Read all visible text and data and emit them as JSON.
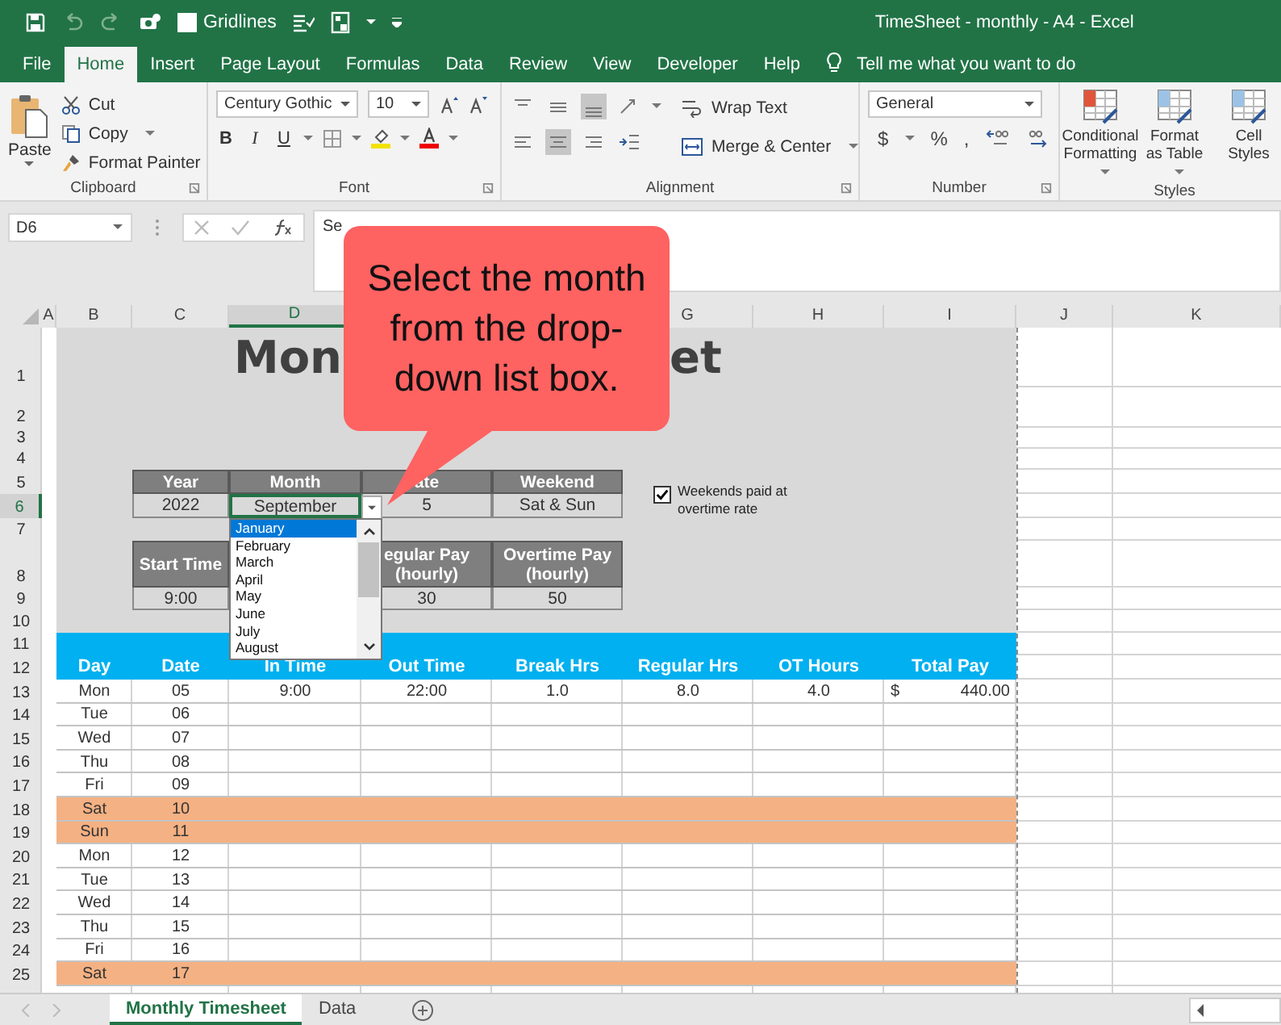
{
  "title_bar": {
    "gridlines": {
      "label": "Gridlines",
      "checked": false
    },
    "title": "TimeSheet - monthly - A4 - Excel"
  },
  "ribbon_tabs": [
    {
      "label": "File",
      "selected": false
    },
    {
      "label": "Home",
      "selected": true
    },
    {
      "label": "Insert",
      "selected": false
    },
    {
      "label": "Page Layout",
      "selected": false
    },
    {
      "label": "Formulas",
      "selected": false
    },
    {
      "label": "Data",
      "selected": false
    },
    {
      "label": "Review",
      "selected": false
    },
    {
      "label": "View",
      "selected": false
    },
    {
      "label": "Developer",
      "selected": false
    },
    {
      "label": "Help",
      "selected": false
    }
  ],
  "tell_me": "Tell me what you want to do",
  "clipboard": {
    "paste": "Paste",
    "cut": "Cut",
    "copy": "Copy",
    "format_painter": "Format Painter",
    "label": "Clipboard"
  },
  "font": {
    "name": "Century Gothic",
    "size": "10",
    "bold": "B",
    "italic": "I",
    "underline": "U",
    "label": "Font"
  },
  "alignment": {
    "wrap_text": "Wrap Text",
    "merge_center": "Merge & Center",
    "label": "Alignment"
  },
  "number": {
    "format": "General",
    "currency": "$",
    "percent": "%",
    "comma": ",",
    "label": "Number"
  },
  "styles": {
    "buttons": [
      {
        "label": "Conditional Formatting",
        "dropdown": true
      },
      {
        "label": "Format as Table",
        "dropdown": true
      },
      {
        "label": "Cell Styles",
        "dropdown": false
      }
    ],
    "label": "Styles"
  },
  "formula_bar": {
    "name_box": "D6",
    "value": "Se"
  },
  "columns": [
    {
      "label": "A",
      "selected": false
    },
    {
      "label": "B",
      "selected": false
    },
    {
      "label": "C",
      "selected": false
    },
    {
      "label": "D",
      "selected": true
    },
    {
      "label": "G",
      "selected": false
    },
    {
      "label": "H",
      "selected": false
    },
    {
      "label": "I",
      "selected": false
    },
    {
      "label": "J",
      "selected": false
    },
    {
      "label": "K",
      "selected": false
    }
  ],
  "row_numbers": [
    {
      "label": "1",
      "selected": false
    },
    {
      "label": "2",
      "selected": false
    },
    {
      "label": "3",
      "selected": false
    },
    {
      "label": "4",
      "selected": false
    },
    {
      "label": "5",
      "selected": false
    },
    {
      "label": "6",
      "selected": true
    },
    {
      "label": "7",
      "selected": false
    },
    {
      "label": "8",
      "selected": false
    },
    {
      "label": "9",
      "selected": false
    },
    {
      "label": "10",
      "selected": false
    },
    {
      "label": "11",
      "selected": false
    },
    {
      "label": "12",
      "selected": false
    },
    {
      "label": "13",
      "selected": false
    },
    {
      "label": "14",
      "selected": false
    },
    {
      "label": "15",
      "selected": false
    },
    {
      "label": "16",
      "selected": false
    },
    {
      "label": "17",
      "selected": false
    },
    {
      "label": "18",
      "selected": false
    },
    {
      "label": "19",
      "selected": false
    },
    {
      "label": "20",
      "selected": false
    },
    {
      "label": "21",
      "selected": false
    },
    {
      "label": "22",
      "selected": false
    },
    {
      "label": "23",
      "selected": false
    },
    {
      "label": "24",
      "selected": false
    },
    {
      "label": "25",
      "selected": false
    }
  ],
  "sheet": {
    "title_parts": [
      "Mon",
      "et"
    ],
    "settings": [
      {
        "header": "Year",
        "value": "2022"
      },
      {
        "header": "Month",
        "value": "September"
      },
      {
        "header": "ate",
        "value": "5"
      },
      {
        "header": "Weekend",
        "value": "Sat & Sun"
      }
    ],
    "weekend_overtime": {
      "label": "Weekends paid at overtime rate",
      "checked": true
    },
    "rates": [
      {
        "header": "Start Time",
        "value": "9:00"
      },
      {
        "header": "egular Pay (hourly)",
        "value": "30"
      },
      {
        "header": "Overtime Pay (hourly)",
        "value": "50"
      }
    ]
  },
  "month_dropdown": {
    "items": [
      {
        "label": "January",
        "selected": true
      },
      {
        "label": "February",
        "selected": false
      },
      {
        "label": "March",
        "selected": false
      },
      {
        "label": "April",
        "selected": false
      },
      {
        "label": "May",
        "selected": false
      },
      {
        "label": "June",
        "selected": false
      },
      {
        "label": "July",
        "selected": false
      },
      {
        "label": "August",
        "selected": false
      }
    ]
  },
  "table": {
    "columns": [
      "Day",
      "Date",
      "In Time",
      "Out Time",
      "Break Hrs",
      "Regular Hrs",
      "OT Hours",
      "Total Pay"
    ],
    "rows": [
      {
        "day": "Mon",
        "date": "05",
        "weekend": false,
        "values": [
          "9:00",
          "22:00",
          "1.0",
          "8.0",
          "4.0"
        ],
        "currency": "$",
        "total_pay": "440.00"
      },
      {
        "day": "Tue",
        "date": "06",
        "weekend": false
      },
      {
        "day": "Wed",
        "date": "07",
        "weekend": false
      },
      {
        "day": "Thu",
        "date": "08",
        "weekend": false
      },
      {
        "day": "Fri",
        "date": "09",
        "weekend": false
      },
      {
        "day": "Sat",
        "date": "10",
        "weekend": true
      },
      {
        "day": "Sun",
        "date": "11",
        "weekend": true
      },
      {
        "day": "Mon",
        "date": "12",
        "weekend": false
      },
      {
        "day": "Tue",
        "date": "13",
        "weekend": false
      },
      {
        "day": "Wed",
        "date": "14",
        "weekend": false
      },
      {
        "day": "Thu",
        "date": "15",
        "weekend": false
      },
      {
        "day": "Fri",
        "date": "16",
        "weekend": false
      },
      {
        "day": "Sat",
        "date": "17",
        "weekend": true
      }
    ]
  },
  "sheet_tabs": [
    {
      "label": "Monthly Timesheet",
      "selected": true
    },
    {
      "label": "Data",
      "selected": false
    }
  ],
  "callout": "Select the month from the drop-down list box."
}
